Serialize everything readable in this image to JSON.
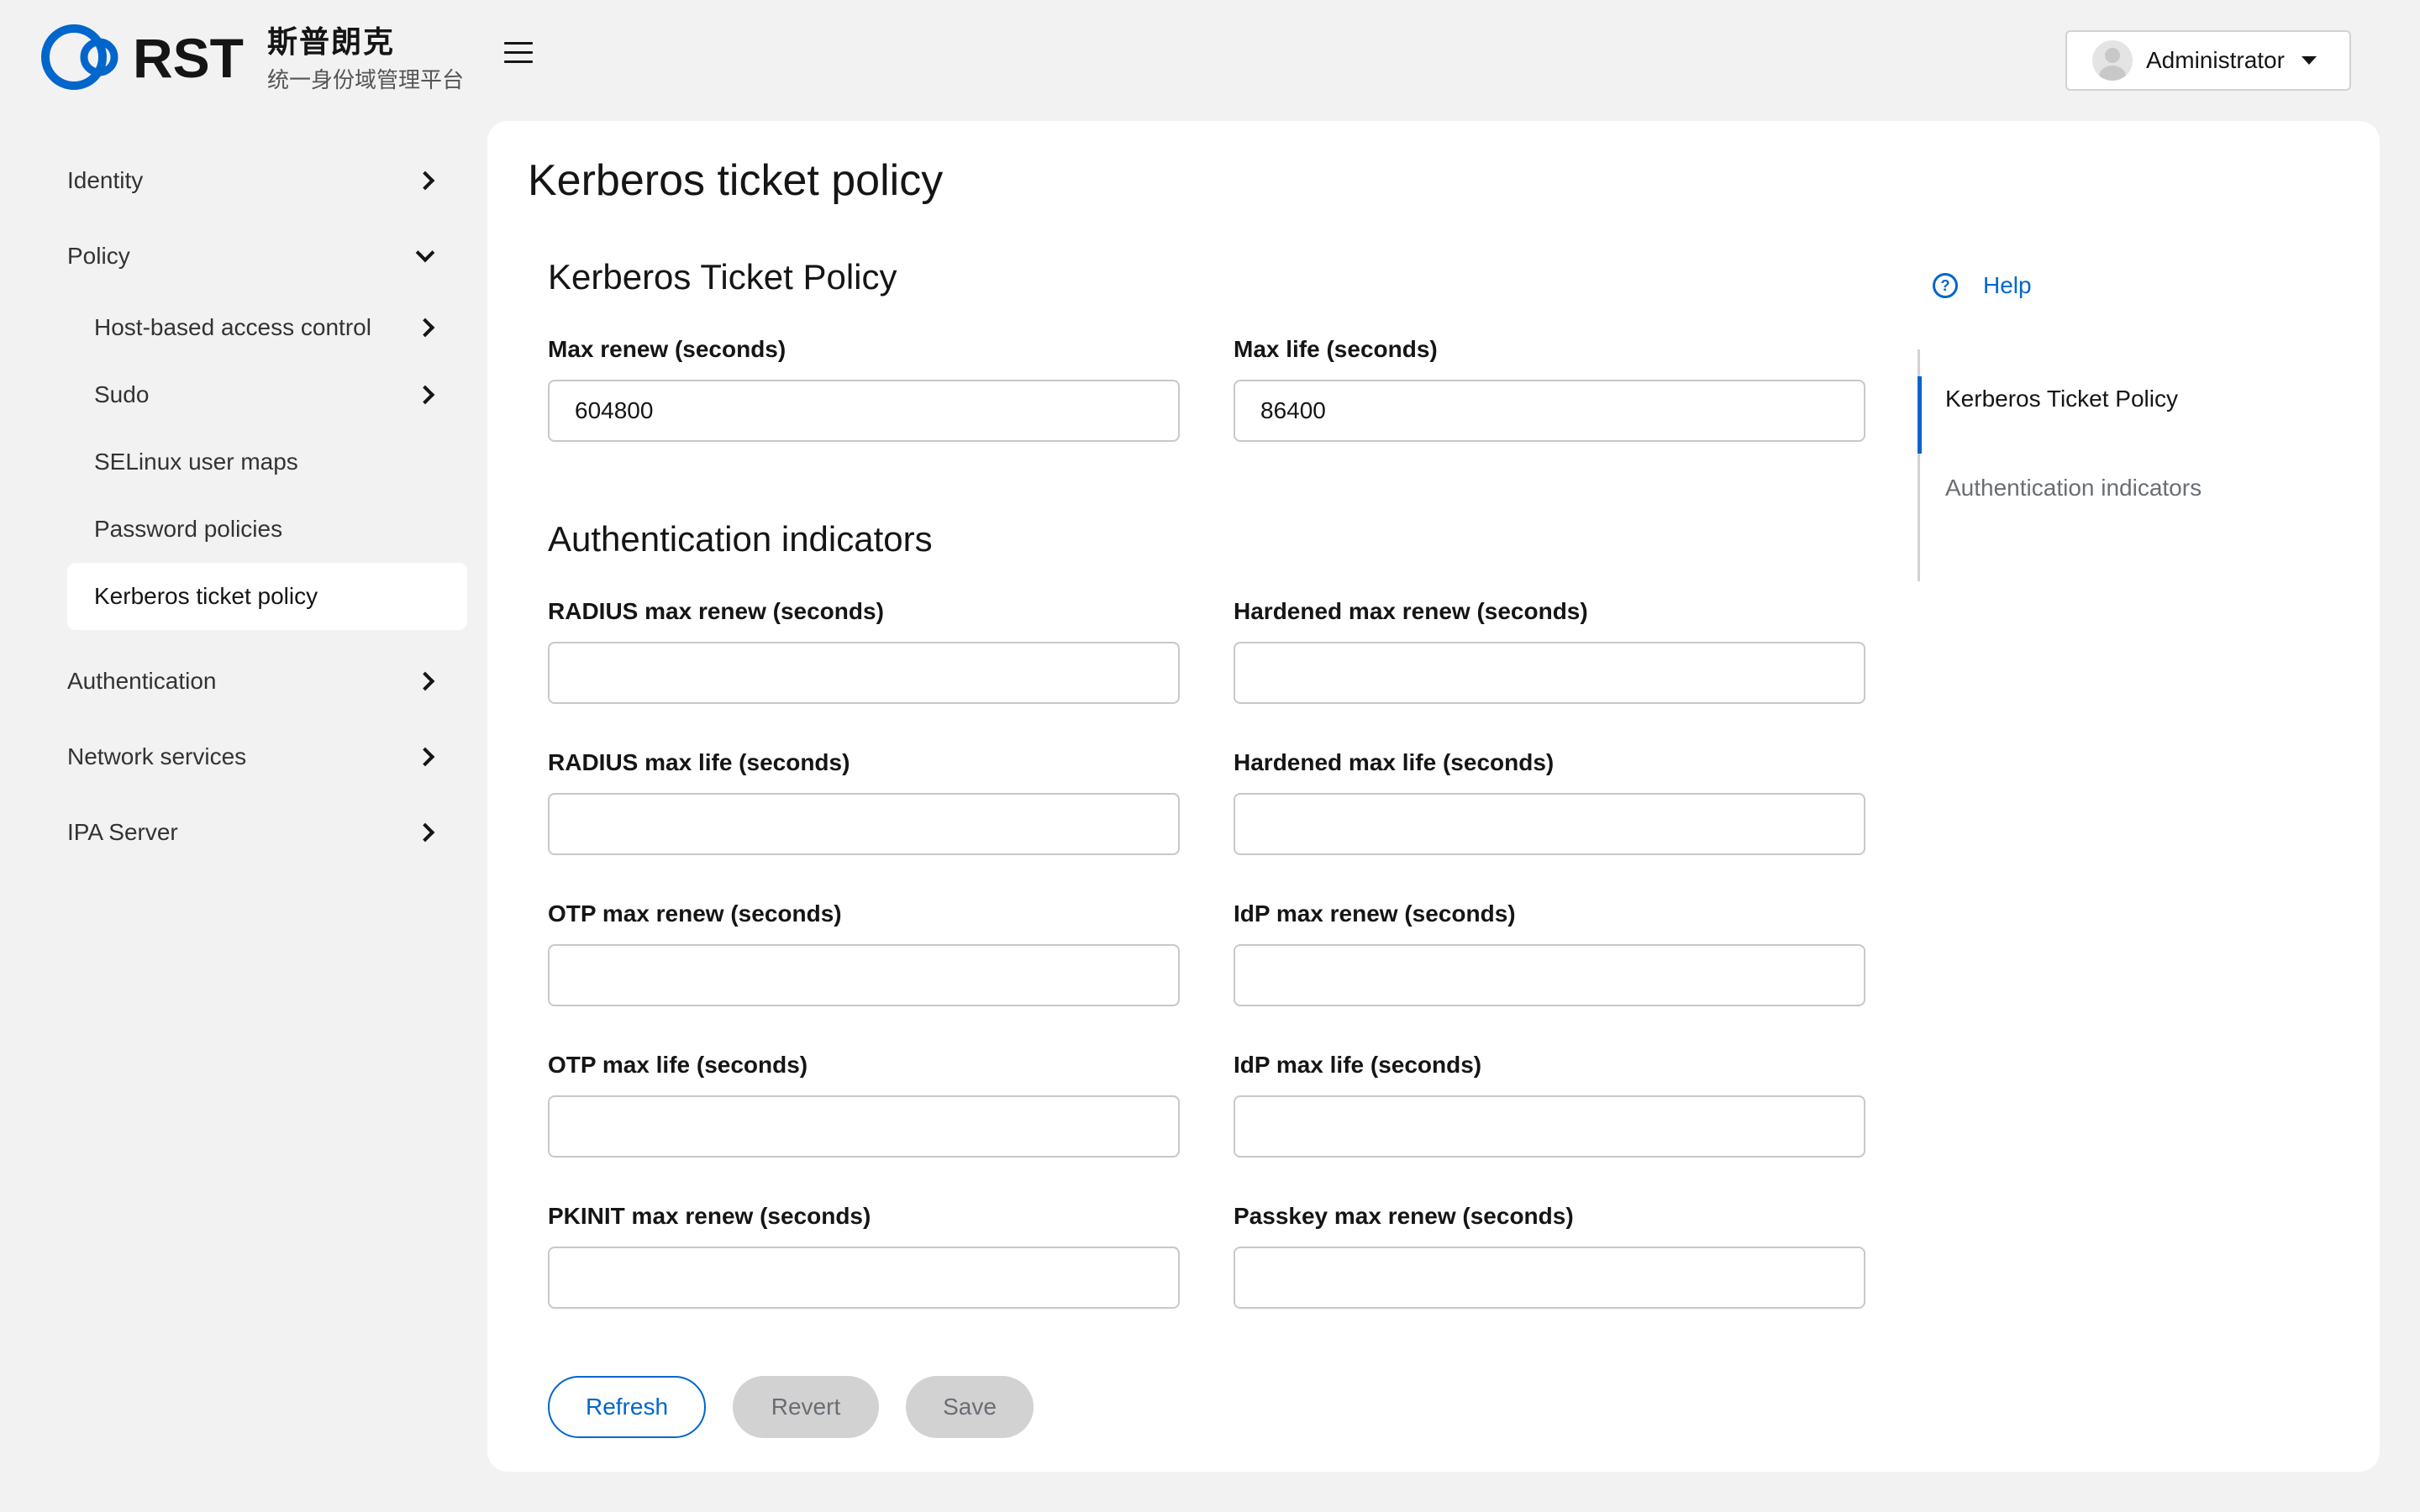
{
  "brand": {
    "logo_text": "RST",
    "name_cn": "斯普朗克",
    "subtitle_cn": "统一身份域管理平台",
    "accent": "#0066cc"
  },
  "header": {
    "user": "Administrator"
  },
  "sidebar": {
    "items": [
      {
        "label": "Identity"
      },
      {
        "label": "Policy",
        "children": [
          {
            "label": "Host-based access control"
          },
          {
            "label": "Sudo"
          },
          {
            "label": "SELinux user maps"
          },
          {
            "label": "Password policies"
          },
          {
            "label": "Kerberos ticket policy"
          }
        ]
      },
      {
        "label": "Authentication"
      },
      {
        "label": "Network services"
      },
      {
        "label": "IPA Server"
      }
    ]
  },
  "main": {
    "page_title": "Kerberos ticket policy",
    "section1_title": "Kerberos Ticket Policy",
    "section2_title": "Authentication indicators",
    "fields": {
      "max_renew": {
        "label": "Max renew (seconds)",
        "value": "604800"
      },
      "max_life": {
        "label": "Max life (seconds)",
        "value": "86400"
      },
      "radius_max_renew": {
        "label": "RADIUS max renew (seconds)",
        "value": ""
      },
      "hardened_max_renew": {
        "label": "Hardened max renew (seconds)",
        "value": ""
      },
      "radius_max_life": {
        "label": "RADIUS max life (seconds)",
        "value": ""
      },
      "hardened_max_life": {
        "label": "Hardened max life (seconds)",
        "value": ""
      },
      "otp_max_renew": {
        "label": "OTP max renew (seconds)",
        "value": ""
      },
      "idp_max_renew": {
        "label": "IdP max renew (seconds)",
        "value": ""
      },
      "otp_max_life": {
        "label": "OTP max life (seconds)",
        "value": ""
      },
      "idp_max_life": {
        "label": "IdP max life (seconds)",
        "value": ""
      },
      "pkinit_max_renew": {
        "label": "PKINIT max renew (seconds)",
        "value": ""
      },
      "passkey_max_renew": {
        "label": "Passkey max renew (seconds)",
        "value": ""
      }
    },
    "buttons": {
      "refresh": "Refresh",
      "revert": "Revert",
      "save": "Save"
    }
  },
  "right": {
    "help": "Help",
    "toc": [
      "Kerberos Ticket Policy",
      "Authentication indicators"
    ]
  }
}
